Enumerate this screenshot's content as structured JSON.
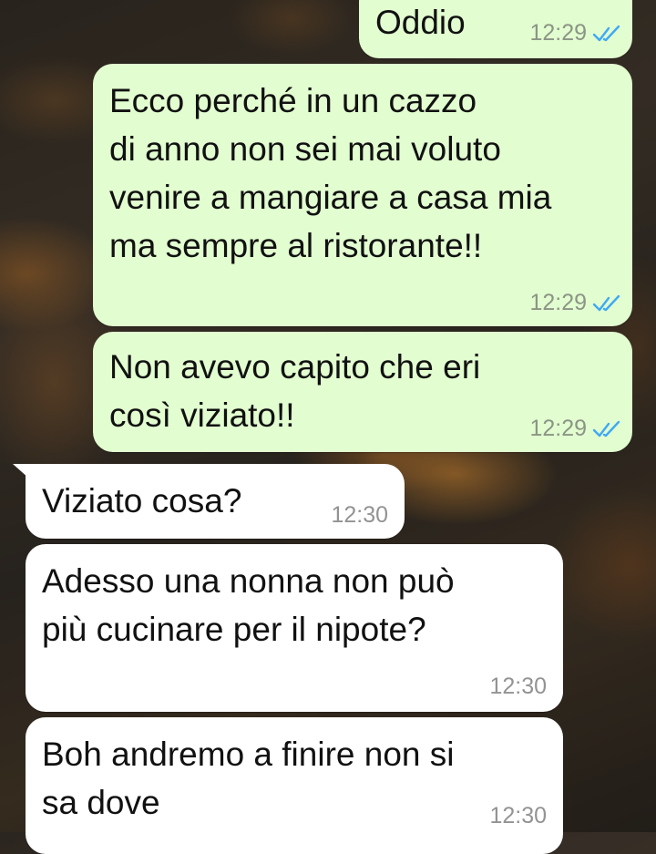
{
  "conversation": {
    "messages": [
      {
        "direction": "outgoing",
        "text": "Oddio",
        "time": "12:29",
        "status": "read"
      },
      {
        "direction": "outgoing",
        "text": "Ecco perché in un cazzo\ndi anno non sei mai voluto\nvenire a mangiare a casa mia\nma sempre al ristorante!!",
        "time": "12:29",
        "status": "read"
      },
      {
        "direction": "outgoing",
        "text": "Non avevo capito che eri\ncosì viziato!!",
        "time": "12:29",
        "status": "read"
      },
      {
        "direction": "incoming",
        "text": "Viziato cosa?",
        "time": "12:30"
      },
      {
        "direction": "incoming",
        "text": "Adesso una nonna non può\npiù cucinare per il nipote?",
        "time": "12:30"
      },
      {
        "direction": "incoming",
        "text": "Boh andremo a finire non si\nsa dove",
        "time": "12:30"
      }
    ]
  },
  "colors": {
    "outgoing_bubble": "#e2fdd0",
    "incoming_bubble": "#ffffff",
    "read_ticks": "#3fa9f5",
    "timestamp": "#8b9585"
  },
  "icons": {
    "read_status": "double-check-icon"
  }
}
